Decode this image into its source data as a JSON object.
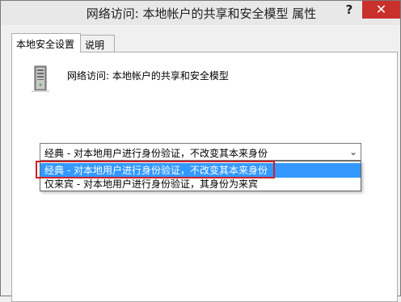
{
  "window": {
    "title": "网络访问: 本地帐户的共享和安全模型 属性",
    "help_label": "?",
    "close_label": "✕"
  },
  "tabs": [
    {
      "label": "本地安全设置",
      "active": true
    },
    {
      "label": "说明",
      "active": false
    }
  ],
  "policy": {
    "name": "网络访问: 本地帐户的共享和安全模型",
    "icon": "server-tower-icon"
  },
  "combo": {
    "selected_value": "经典 - 对本地用户进行身份验证，不改变其本来身份",
    "arrow": "⌄"
  },
  "dropdown": {
    "options": [
      "经典 - 对本地用户进行身份验证，不改变其本来身份",
      "仅来宾 - 对本地用户进行身份验证，其身份为来宾"
    ],
    "highlighted_index": 0
  },
  "colors": {
    "selection": "#3399ff",
    "close_button": "#c9302c",
    "annotation_box": "#d0202a"
  }
}
